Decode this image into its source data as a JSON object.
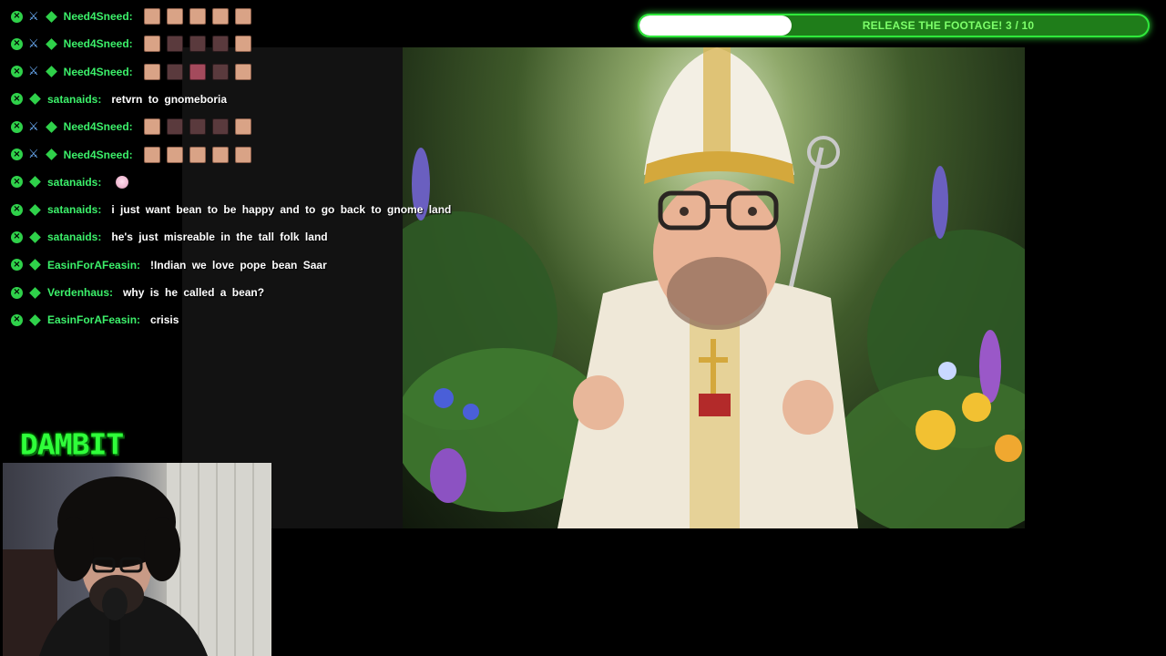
{
  "chat": {
    "messages": [
      {
        "user": "Need4Sneed:",
        "sword": true,
        "text": "",
        "emotes": [
          "light",
          "light",
          "light",
          "light",
          "light"
        ]
      },
      {
        "user": "Need4Sneed:",
        "sword": true,
        "text": "",
        "emotes": [
          "light",
          "dark",
          "dark",
          "dark",
          "light"
        ]
      },
      {
        "user": "Need4Sneed:",
        "sword": true,
        "text": "",
        "emotes": [
          "light",
          "dark",
          "red",
          "dark",
          "light"
        ]
      },
      {
        "user": "satanaids:",
        "sword": false,
        "text": "retvrn to gnomeboria",
        "emotes": []
      },
      {
        "user": "Need4Sneed:",
        "sword": true,
        "text": "",
        "emotes": [
          "light",
          "dark",
          "dark",
          "dark",
          "light"
        ]
      },
      {
        "user": "Need4Sneed:",
        "sword": true,
        "text": "",
        "emotes": [
          "light",
          "light",
          "light",
          "light",
          "light"
        ]
      },
      {
        "user": "satanaids:",
        "sword": false,
        "text": "",
        "emotes": [
          "bunny"
        ]
      },
      {
        "user": "satanaids:",
        "sword": false,
        "text": "i just want bean to be happy and to go back to gnome land",
        "emotes": []
      },
      {
        "user": "satanaids:",
        "sword": false,
        "text": "he's just misreable in the tall folk land",
        "emotes": []
      },
      {
        "user": "EasinForAFeasin:",
        "sword": false,
        "text": "!Indian we love pope bean Saar",
        "emotes": []
      },
      {
        "user": "Verdenhaus:",
        "sword": false,
        "text": "why is he called a bean?",
        "emotes": []
      },
      {
        "user": "EasinForAFeasin:",
        "sword": false,
        "text": "crisis",
        "emotes": []
      }
    ]
  },
  "progress": {
    "label": "RELEASE THE FOOTAGE! 3 / 10",
    "current": 3,
    "total": 10,
    "fraction": 0.3
  },
  "logo": {
    "text": "DAMBIT"
  },
  "colors": {
    "username": "#3cf06a",
    "progress_border": "#2fe83b",
    "progress_track": "#1f7d1a",
    "progress_fill": "#ffffff",
    "logo": "#2fff3a"
  }
}
